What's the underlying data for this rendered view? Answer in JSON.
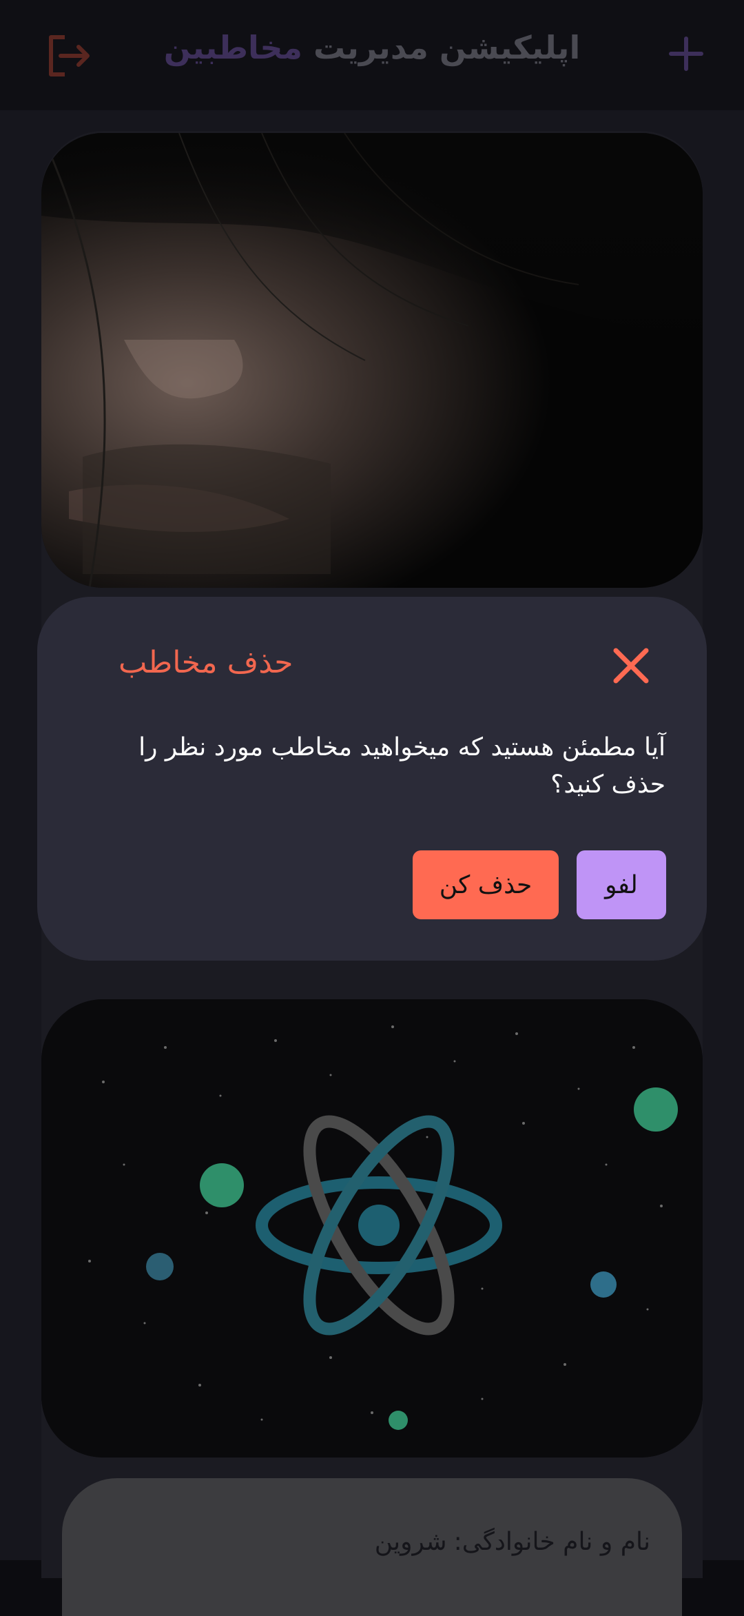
{
  "header": {
    "title_main": "اپلیکیشن مدیریت",
    "title_accent": "مخاطبین",
    "logout_icon": "logout-icon",
    "add_icon": "plus-icon"
  },
  "dialog": {
    "title": "حذف مخاطب",
    "message": "آیا مطمئن هستید که میخواهید مخاطب مورد نظر را حذف کنید؟",
    "delete_label": "حذف کن",
    "cancel_label": "لفو",
    "close_icon": "close-icon"
  },
  "contact": {
    "name_label": "نام و نام خانوادگی:",
    "name_value": "شروین"
  },
  "colors": {
    "accent_red": "#ff6a52",
    "accent_purple": "#bf94f6",
    "dialog_bg": "#2b2b38"
  }
}
